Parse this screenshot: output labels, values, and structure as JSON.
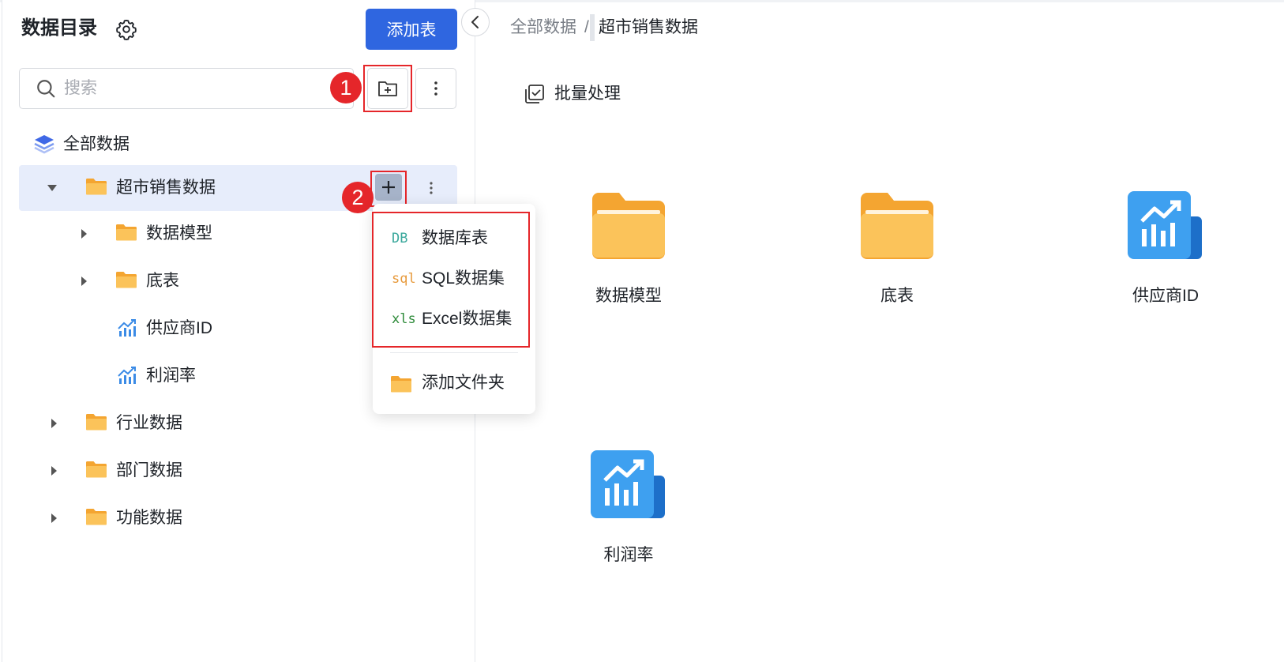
{
  "sidebar": {
    "title": "数据目录",
    "add_table_label": "添加表",
    "search_placeholder": "搜索",
    "annotations": {
      "badge1": "1",
      "badge2": "2"
    },
    "tree": {
      "root": "全部数据",
      "items": [
        {
          "label": "超市销售数据",
          "icon": "folder-icon",
          "expanded": true,
          "selected": true
        },
        {
          "label": "数据模型",
          "icon": "folder-icon"
        },
        {
          "label": "底表",
          "icon": "folder-icon"
        },
        {
          "label": "供应商ID",
          "icon": "metric-chart-icon"
        },
        {
          "label": "利润率",
          "icon": "metric-chart-icon"
        },
        {
          "label": "行业数据",
          "icon": "folder-icon"
        },
        {
          "label": "部门数据",
          "icon": "folder-icon"
        },
        {
          "label": "功能数据",
          "icon": "folder-icon"
        }
      ]
    }
  },
  "dropdown": {
    "items": [
      {
        "icon_text": "DB",
        "label": "数据库表",
        "color": "#3aa89c"
      },
      {
        "icon_text": "sql",
        "label": "SQL数据集",
        "color": "#e79a3c"
      },
      {
        "icon_text": "xls",
        "label": "Excel数据集",
        "color": "#2e8b3a"
      },
      {
        "icon_text": "",
        "label": "添加文件夹"
      }
    ]
  },
  "main": {
    "breadcrumb": {
      "root": "全部数据",
      "separator": "/",
      "current": "超市销售数据"
    },
    "batch_label": "批量处理",
    "cards": [
      {
        "label": "数据模型",
        "type": "folder"
      },
      {
        "label": "底表",
        "type": "folder"
      },
      {
        "label": "供应商ID",
        "type": "metric"
      },
      {
        "label": "利润率",
        "type": "metric"
      }
    ]
  },
  "colors": {
    "primary": "#2f66e0",
    "selected_row": "#e7edfb",
    "annotation_red": "#e5262a",
    "folder": "#f6b23b"
  }
}
